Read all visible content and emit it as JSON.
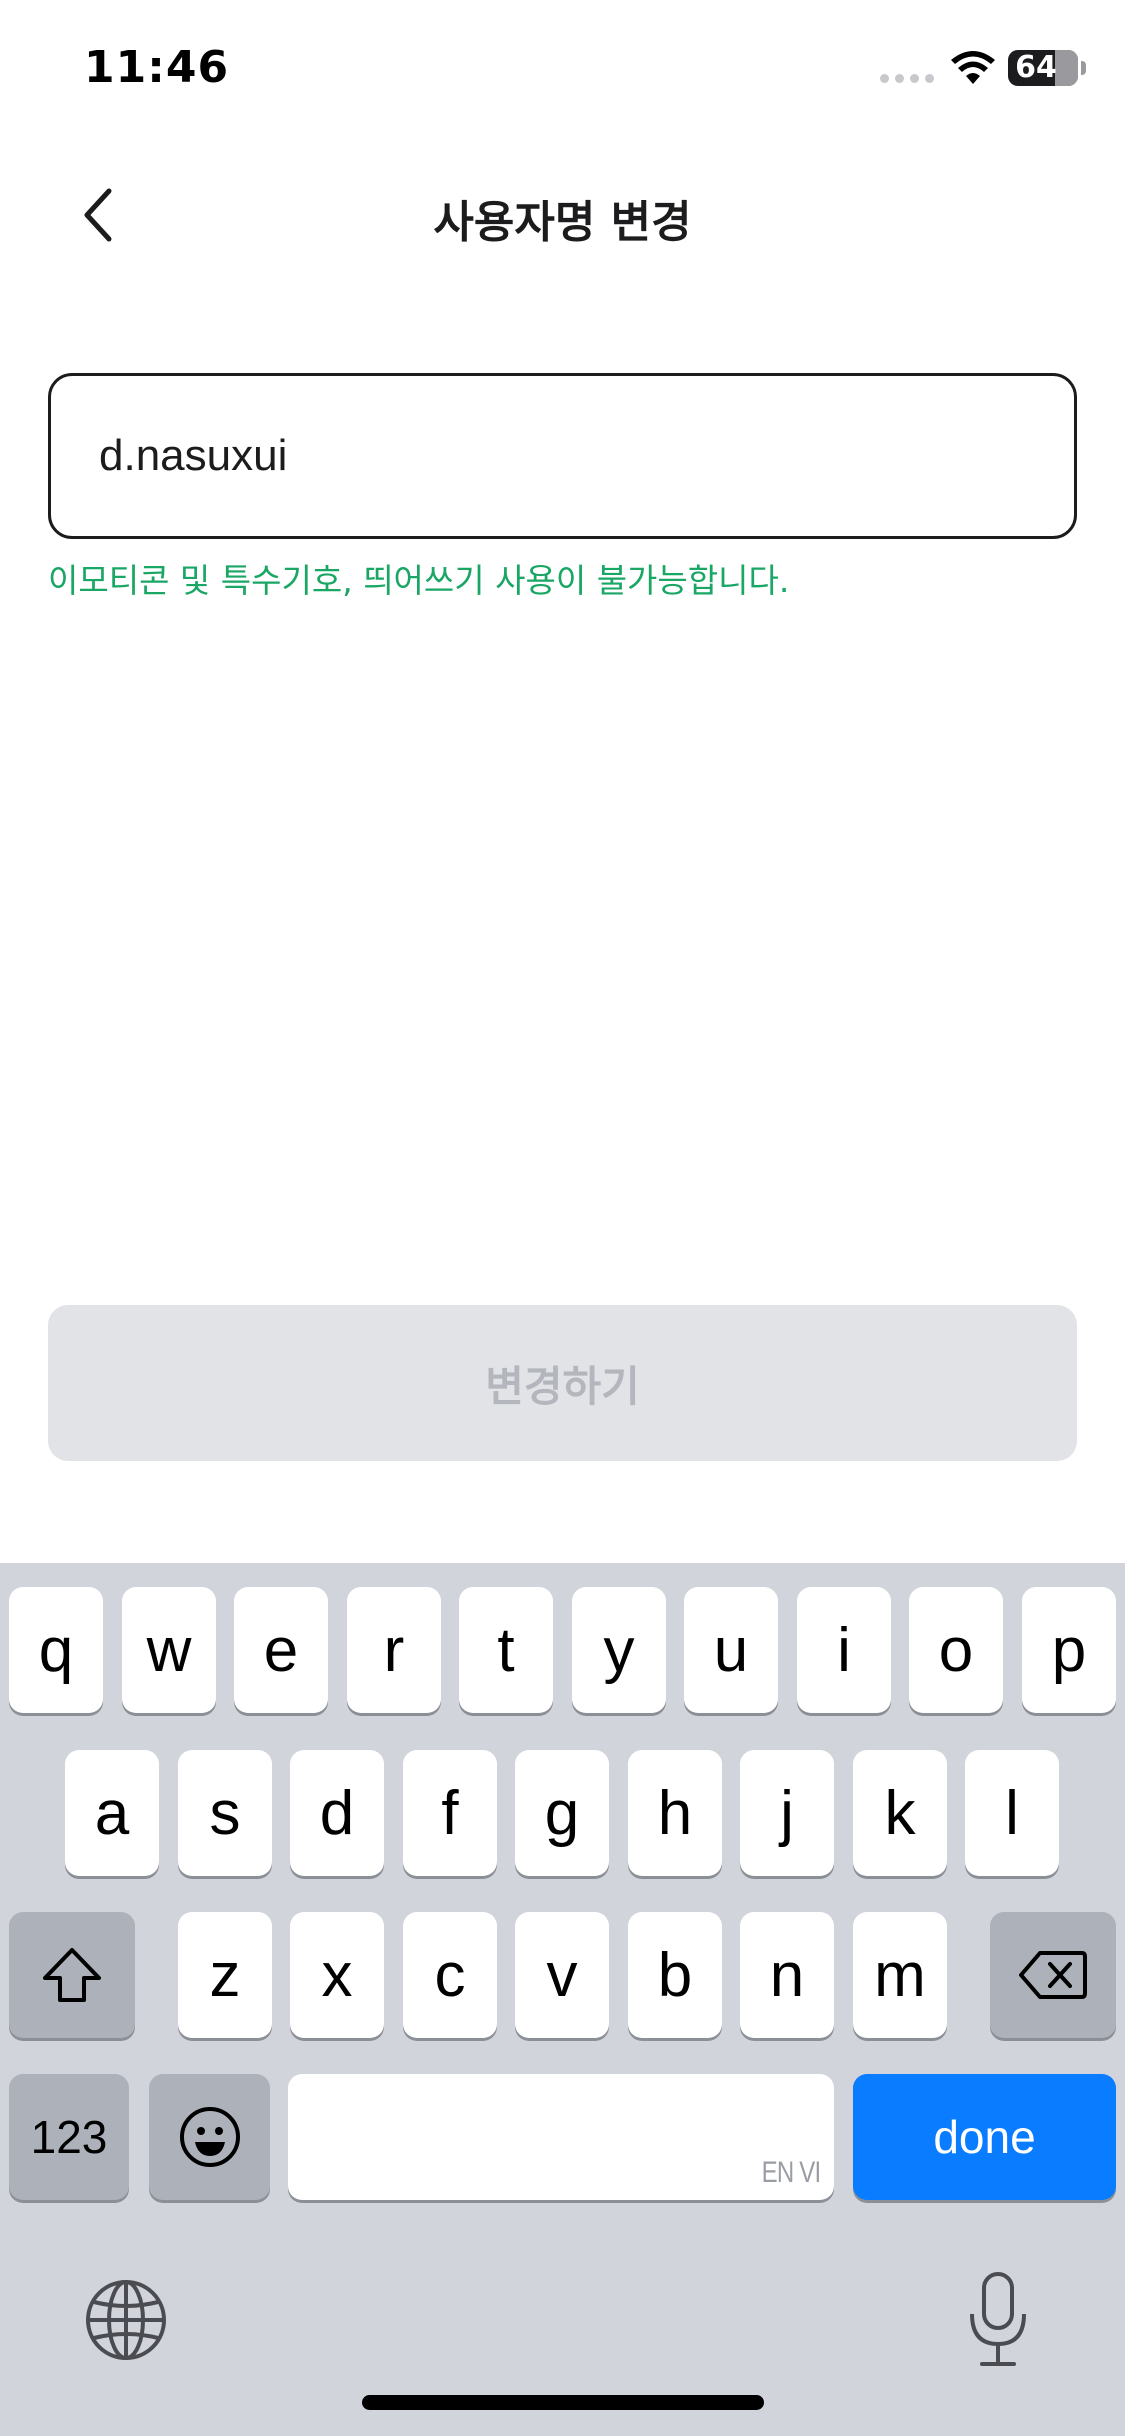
{
  "status_bar": {
    "time": "11:46",
    "battery": "64"
  },
  "nav": {
    "title": "사용자명 변경",
    "back_icon": "chevron-left-icon"
  },
  "username_field": {
    "value": "d.nasuxui",
    "helper": "이모티콘 및 특수기호, 띄어쓰기 사용이 불가능합니다."
  },
  "change_button": {
    "label": "변경하기",
    "enabled": false
  },
  "keyboard": {
    "row1": [
      "q",
      "w",
      "e",
      "r",
      "t",
      "y",
      "u",
      "i",
      "o",
      "p"
    ],
    "row2": [
      "a",
      "s",
      "d",
      "f",
      "g",
      "h",
      "j",
      "k",
      "l"
    ],
    "row3": [
      "z",
      "x",
      "c",
      "v",
      "b",
      "n",
      "m"
    ],
    "numbers_label": "123",
    "space_hint": "EN VI",
    "done_label": "done"
  },
  "colors": {
    "helper_text": "#1aa665",
    "done_key": "#0a7cff",
    "disabled_button": "#e1e3e7"
  }
}
